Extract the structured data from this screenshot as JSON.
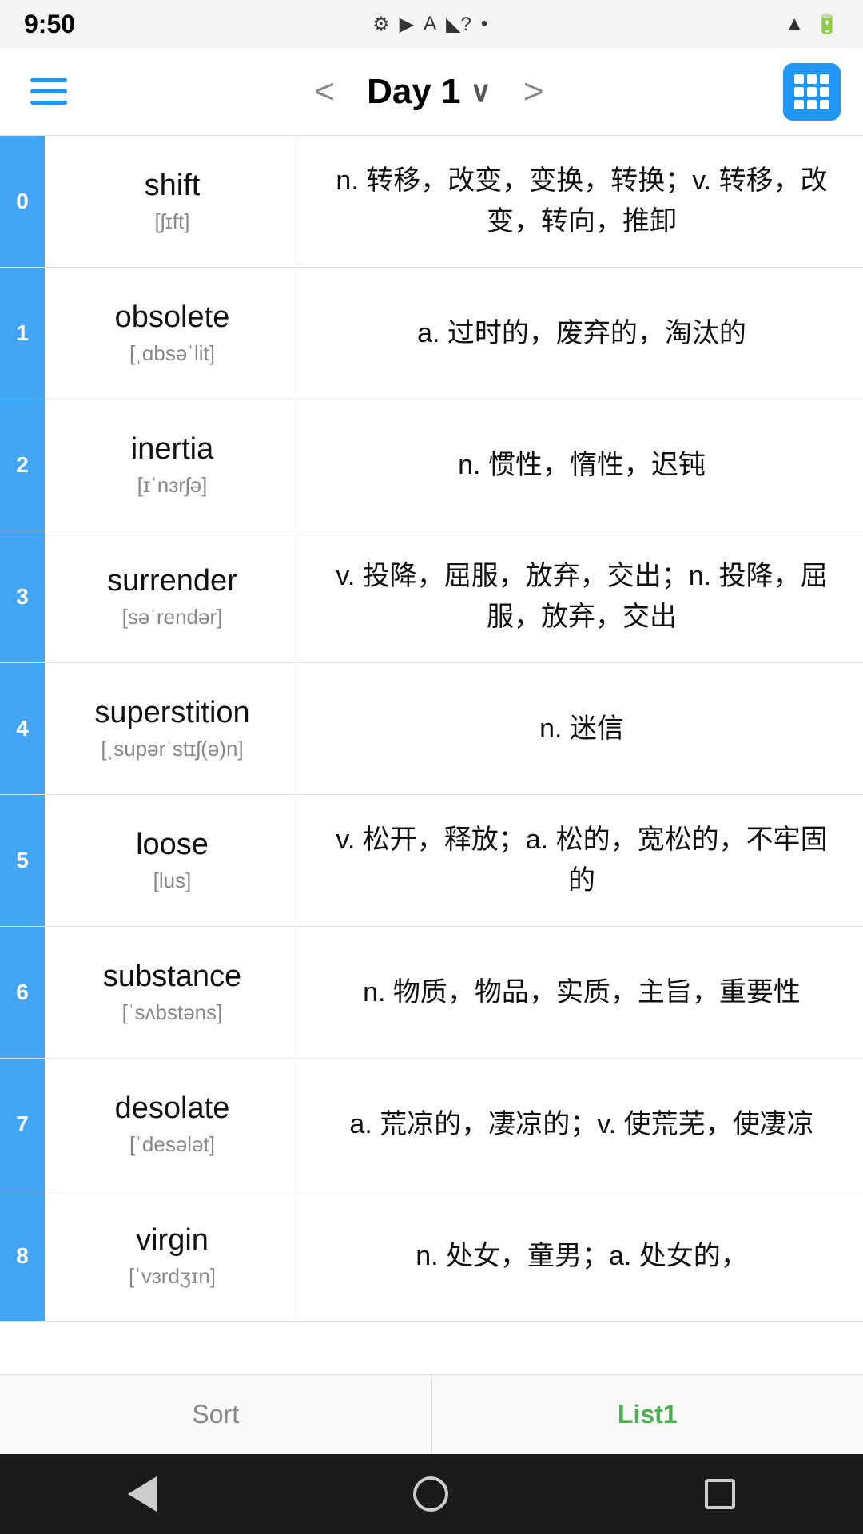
{
  "statusBar": {
    "time": "9:50",
    "icons": [
      "⚙",
      "▶",
      "A",
      "?",
      "•"
    ]
  },
  "toolbar": {
    "menu_label": "Menu",
    "prev_label": "<",
    "title": "Day 1",
    "chevron": "∨",
    "next_label": ">",
    "grid_label": "Grid View"
  },
  "words": [
    {
      "index": "0",
      "english": "shift",
      "phonetic": "[ʃɪft]",
      "definition": "n. 转移，改变，变换，转换；v. 转移，改变，转向，推卸"
    },
    {
      "index": "1",
      "english": "obsolete",
      "phonetic": "[ˌɑbsəˈlit]",
      "definition": "a. 过时的，废弃的，淘汰的"
    },
    {
      "index": "2",
      "english": "inertia",
      "phonetic": "[ɪˈnɜrʃə]",
      "definition": "n. 惯性，惰性，迟钝"
    },
    {
      "index": "3",
      "english": "surrender",
      "phonetic": "[səˈrendər]",
      "definition": "v. 投降，屈服，放弃，交出；n. 投降，屈服，放弃，交出"
    },
    {
      "index": "4",
      "english": "superstition",
      "phonetic": "[ˌsupərˈstɪʃ(ə)n]",
      "definition": "n. 迷信"
    },
    {
      "index": "5",
      "english": "loose",
      "phonetic": "[lus]",
      "definition": "v. 松开，释放；a. 松的，宽松的，不牢固的"
    },
    {
      "index": "6",
      "english": "substance",
      "phonetic": "[ˈsʌbstəns]",
      "definition": "n. 物质，物品，实质，主旨，重要性"
    },
    {
      "index": "7",
      "english": "desolate",
      "phonetic": "[ˈdesələt]",
      "definition": "a. 荒凉的，凄凉的；v. 使荒芜，使凄凉"
    },
    {
      "index": "8",
      "english": "virgin",
      "phonetic": "[ˈvɜrdʒɪn]",
      "definition": "n. 处女，童男；a. 处女的，"
    }
  ],
  "bottomBar": {
    "sort_label": "Sort",
    "list1_label": "List1"
  },
  "navBar": {
    "back_label": "Back",
    "home_label": "Home",
    "recent_label": "Recent"
  }
}
